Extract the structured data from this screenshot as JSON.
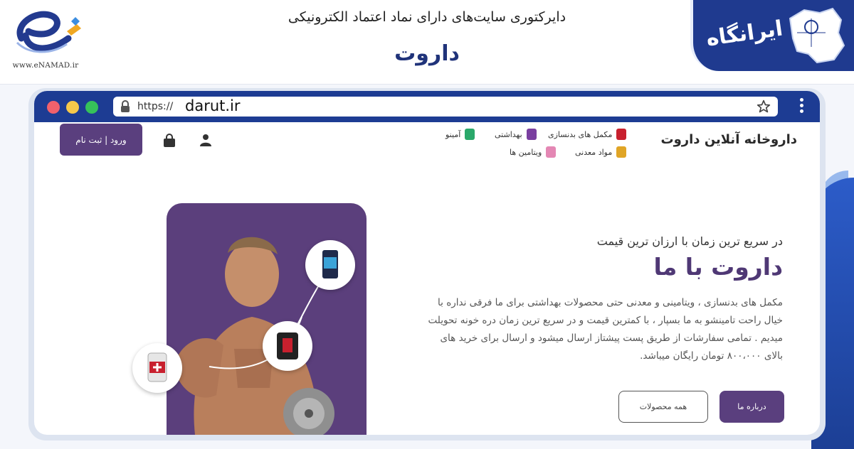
{
  "header": {
    "enamad_url": "www.eNAMAD.ir",
    "directory_title": "دایرکتوری سایت‌های دارای نماد اعتماد الکترونیکی",
    "site_name": "داروت",
    "irangah_logo": "ایرانگاه"
  },
  "browser": {
    "protocol": "https://",
    "domain": "darut.ir"
  },
  "nav": {
    "brand": "داروخانه آنلاین داروت",
    "categories": [
      {
        "label": "مکمل های بدنسازی",
        "icon": "supplement-jar-icon",
        "color": "#c8202e"
      },
      {
        "label": "بهداشتی",
        "icon": "hygiene-product-icon",
        "color": "#7a3fa0"
      },
      {
        "label": "آمینو",
        "icon": "amino-jar-icon",
        "color": "#2aa86a"
      },
      {
        "label": "مواد معدنی",
        "icon": "minerals-icon",
        "color": "#e0a526"
      },
      {
        "label": "ویتامین ها",
        "icon": "vitamin-bottle-icon",
        "color": "#e487b4"
      }
    ],
    "login_label": "ورود | ثبت نام"
  },
  "hero": {
    "subtitle": "در سریع ترین زمان با ارزان ترین قیمت",
    "title": "داروت با ما",
    "description": "مکمل های بدنسازی ، ویتامینی و معدنی حتی محصولات بهداشتی برای ما فرقی نداره با خیال راحت تامینشو به ما بسپار ، با کمترین قیمت و در سریع ترین زمان دره خونه تحویلت میدیم . تمامی سفارشات از طریق پست پیشتاز ارسال میشود و ارسال برای خرید های بالای ۸۰۰،۰۰۰ تومان رایگان میباشد.",
    "about_button": "درباره ما",
    "all_products_button": "همه محصولات"
  },
  "colors": {
    "brand_blue": "#1d3c93",
    "brand_purple": "#5a3f7e"
  }
}
